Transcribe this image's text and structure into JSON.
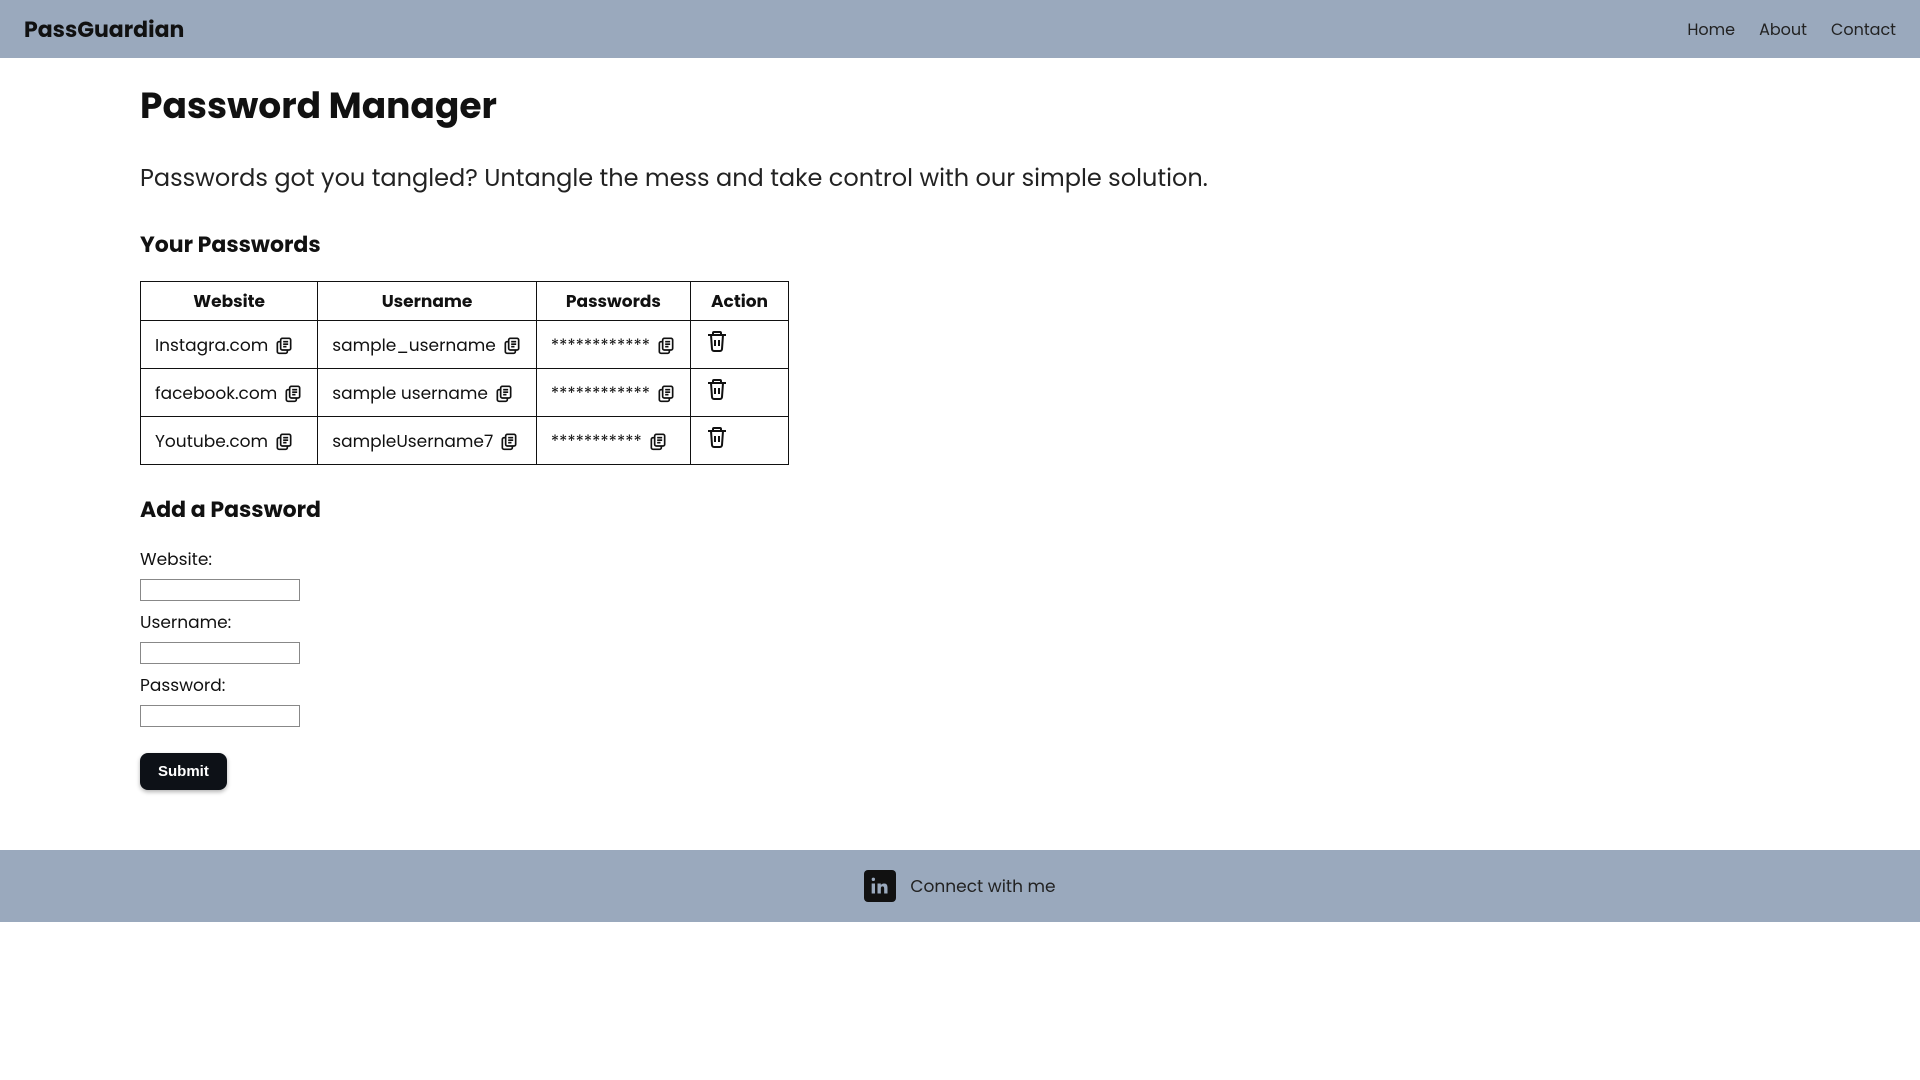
{
  "nav": {
    "brand": "PassGuardian",
    "links": [
      "Home",
      "About",
      "Contact"
    ]
  },
  "page": {
    "title": "Password Manager",
    "tagline": "Passwords got you tangled? Untangle the mess and take control with our simple solution."
  },
  "passwords_section": {
    "heading": "Your Passwords",
    "columns": [
      "Website",
      "Username",
      "Passwords",
      "Action"
    ],
    "rows": [
      {
        "website": "Instagra.com",
        "username": "sample_username",
        "password": "************"
      },
      {
        "website": "facebook.com",
        "username": "sample username",
        "password": "************"
      },
      {
        "website": "Youtube.com",
        "username": "sampleUsername7",
        "password": "***********"
      }
    ]
  },
  "add_section": {
    "heading": "Add a Password",
    "labels": {
      "website": "Website:",
      "username": "Username:",
      "password": "Password:"
    },
    "submit": "Submit"
  },
  "footer": {
    "text": "Connect with me"
  }
}
